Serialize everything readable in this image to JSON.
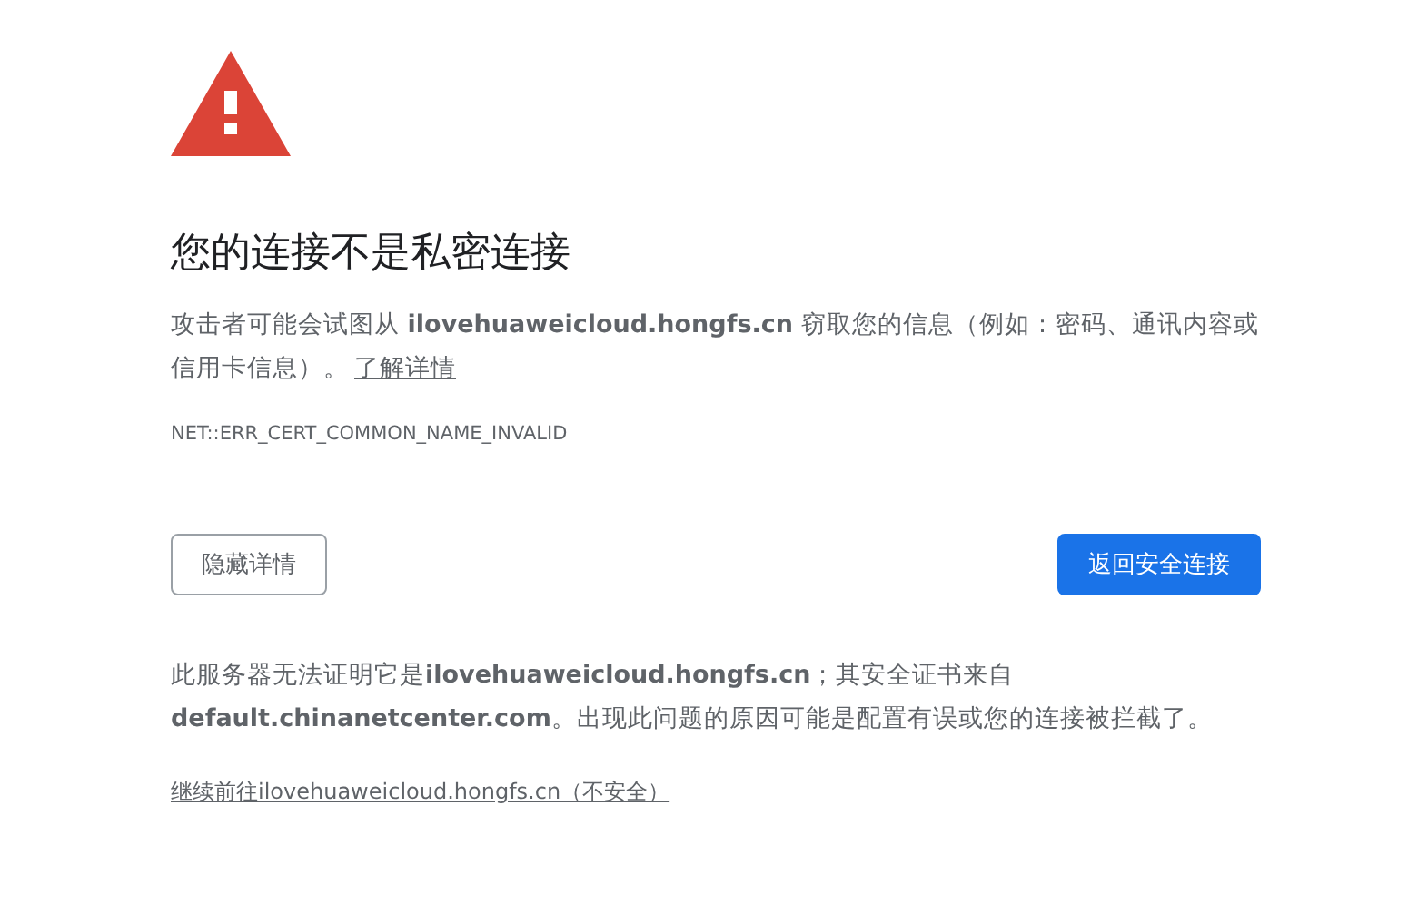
{
  "heading": "您的连接不是私密连接",
  "explanation": {
    "text": "攻击者可能会试图从 **ilovehuaweicloud.hongfs.cn** 窃取您的信息（例如：密码、通讯内容或信用卡信息）。",
    "link": "了解详情"
  },
  "error_code": "NET::ERR_CERT_COMMON_NAME_INVALID",
  "buttons": [
    {
      "label": "隐藏详情",
      "kind": "secondary"
    },
    {
      "label": "返回安全连接",
      "kind": "primary"
    }
  ],
  "details": "此服务器无法证明它是**ilovehuaweicloud.hongfs.cn**；其安全证书来自 **default.chinanetcenter.com**。出现此问题的原因可能是配置有误或您的连接被拦截了。",
  "proceed_link": "继续前往ilovehuaweicloud.hongfs.cn（不安全）"
}
